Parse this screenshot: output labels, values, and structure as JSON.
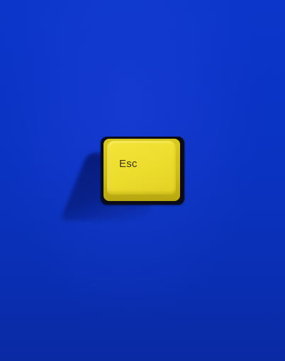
{
  "key": {
    "legend": "Esc"
  },
  "colors": {
    "background": "#0a33c2",
    "keycap": "#ecdc2c",
    "keycap_skirt": "#cdbb16",
    "key_base": "#0a0c1a",
    "legend": "#3a3510"
  }
}
